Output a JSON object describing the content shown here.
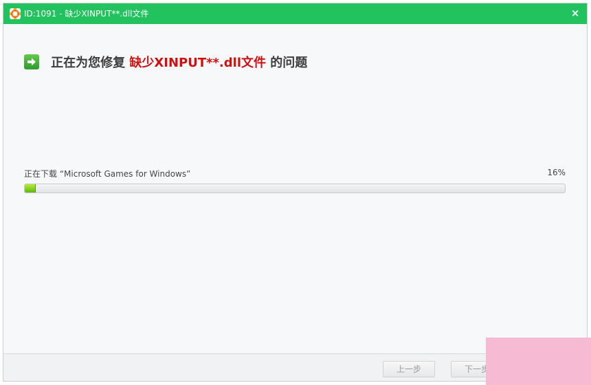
{
  "window": {
    "title": "ID:1091 - 缺少XINPUT**.dll文件",
    "close_label": "×"
  },
  "heading": {
    "prefix": "正在为您修复",
    "highlight": "缺少XINPUT**.dll文件",
    "suffix": "的问题"
  },
  "progress": {
    "label": "正在下载 “Microsoft Games for Windows”",
    "percent_label": "16%",
    "value": 0.02
  },
  "footer": {
    "prev_label": "上一步",
    "next_label": "下一步"
  },
  "colors": {
    "titlebar": "#22c35e",
    "highlight": "#d10f0f",
    "progress_fill": "#7cc51b"
  }
}
